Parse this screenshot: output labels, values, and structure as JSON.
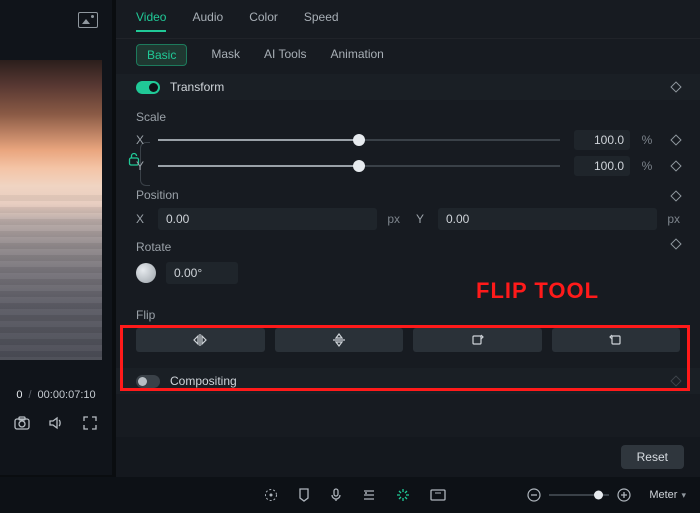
{
  "left": {
    "currentTime": "0",
    "totalTime": "00:00:07:10"
  },
  "tabs": {
    "primary": {
      "video": "Video",
      "audio": "Audio",
      "color": "Color",
      "speed": "Speed"
    },
    "secondary": {
      "basic": "Basic",
      "mask": "Mask",
      "aitools": "AI Tools",
      "animation": "Animation"
    }
  },
  "transform": {
    "label": "Transform",
    "scale": {
      "label": "Scale",
      "x": {
        "axis": "X",
        "value": "100.0",
        "unit": "%"
      },
      "y": {
        "axis": "Y",
        "value": "100.0",
        "unit": "%"
      }
    },
    "position": {
      "label": "Position",
      "x": {
        "axis": "X",
        "value": "0.00",
        "unit": "px"
      },
      "y": {
        "axis": "Y",
        "value": "0.00",
        "unit": "px"
      }
    },
    "rotate": {
      "label": "Rotate",
      "value": "0.00°"
    },
    "flip": {
      "label": "Flip"
    }
  },
  "compositing": {
    "label": "Compositing"
  },
  "reset": "Reset",
  "bottom": {
    "meter": "Meter"
  },
  "annotation": "FLIP TOOL"
}
